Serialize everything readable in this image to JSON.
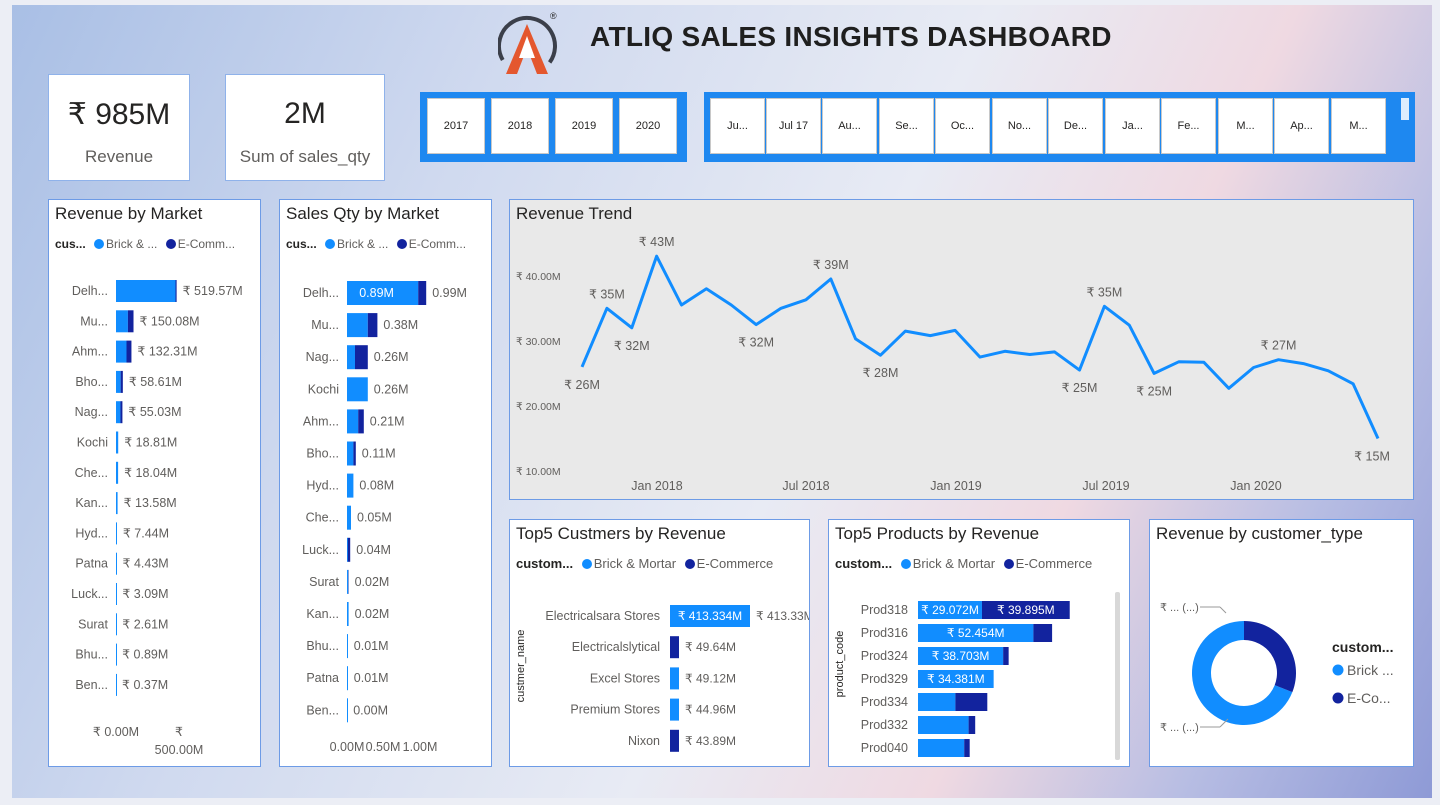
{
  "header": {
    "title": "ATLIQ SALES INSIGHTS DASHBOARD",
    "registered_mark": "®"
  },
  "colors": {
    "brick": "#118dff",
    "ecom": "#12239e",
    "logo_orange": "#e4572e",
    "logo_dark": "#3b3f4a"
  },
  "kpis": [
    {
      "value": "₹ 985M",
      "label": "Revenue"
    },
    {
      "value": "2M",
      "label": "Sum of sales_qty"
    }
  ],
  "year_slicer": [
    "2017",
    "2018",
    "2019",
    "2020"
  ],
  "month_slicer": [
    "Ju...",
    "Jul 17",
    "Au...",
    "Se...",
    "Oc...",
    "No...",
    "De...",
    "Ja...",
    "Fe...",
    "M...",
    "Ap...",
    "M..."
  ],
  "legend_common": {
    "brick_short": "Brick & ...",
    "ecom_short": "E-Comm...",
    "brick_full": "Brick & Mortar",
    "ecom_full": "E-Commerce"
  },
  "chart_data": [
    {
      "id": "revenue_by_market",
      "type": "bar",
      "title": "Revenue by Market",
      "legend_title": "cus...",
      "categories": [
        "Delh...",
        "Mu...",
        "Ahm...",
        "Bho...",
        "Nag...",
        "Kochi",
        "Che...",
        "Kan...",
        "Hyd...",
        "Patna",
        "Luck...",
        "Surat",
        "Bhu...",
        "Ben..."
      ],
      "series": [
        {
          "name": "Brick & ...",
          "values": [
            510,
            102,
            90,
            40,
            38,
            18.81,
            18.04,
            13.58,
            7.44,
            4.43,
            3.09,
            2.61,
            0.89,
            0.37
          ]
        },
        {
          "name": "E-Comm...",
          "values": [
            9.57,
            48.08,
            42.31,
            18.61,
            17.03,
            0,
            0,
            0,
            0,
            0,
            0,
            0,
            0,
            0
          ]
        }
      ],
      "data_labels": [
        "₹ 519.57M",
        "₹ 150.08M",
        "₹ 132.31M",
        "₹ 58.61M",
        "₹ 55.03M",
        "₹ 18.81M",
        "₹ 18.04M",
        "₹ 13.58M",
        "₹ 7.44M",
        "₹ 4.43M",
        "₹ 3.09M",
        "₹ 2.61M",
        "₹ 0.89M",
        "₹ 0.37M"
      ],
      "x_ticks": [
        "₹ 0.00M",
        "₹",
        "500.00M"
      ],
      "xlim": [
        0,
        600
      ]
    },
    {
      "id": "sales_qty_by_market",
      "type": "bar",
      "title": "Sales Qty by Market",
      "legend_title": "cus...",
      "categories": [
        "Delh...",
        "Mu...",
        "Nag...",
        "Kochi",
        "Ahm...",
        "Bho...",
        "Hyd...",
        "Che...",
        "Luck...",
        "Surat",
        "Kan...",
        "Bhu...",
        "Patna",
        "Ben..."
      ],
      "series": [
        {
          "name": "Brick & ...",
          "values": [
            0.89,
            0.26,
            0.1,
            0.26,
            0.14,
            0.08,
            0.08,
            0.05,
            0.01,
            0.015,
            0.02,
            0.01,
            0.01,
            0.003
          ]
        },
        {
          "name": "E-Comm...",
          "values": [
            0.1,
            0.12,
            0.16,
            0,
            0.07,
            0.03,
            0,
            0,
            0.03,
            0.005,
            0,
            0,
            0,
            0
          ]
        }
      ],
      "inner_label": "0.89M",
      "data_labels": [
        "0.99M",
        "0.38M",
        "0.26M",
        "0.26M",
        "0.21M",
        "0.11M",
        "0.08M",
        "0.05M",
        "0.04M",
        "0.02M",
        "0.02M",
        "0.01M",
        "0.01M",
        "0.00M"
      ],
      "x_ticks": [
        "0.00M",
        "0.50M",
        "1.00M"
      ],
      "xlim": [
        0,
        1.0
      ]
    },
    {
      "id": "revenue_trend",
      "type": "line",
      "title": "Revenue Trend",
      "x": [
        "2017-06",
        "2017-07",
        "2017-08",
        "2017-09",
        "2017-10",
        "2017-11",
        "2017-12",
        "2018-01",
        "2018-02",
        "2018-03",
        "2018-04",
        "2018-05",
        "2018-06",
        "2018-07",
        "2018-08",
        "2018-09",
        "2018-10",
        "2018-11",
        "2018-12",
        "2019-01",
        "2019-02",
        "2019-03",
        "2019-04",
        "2019-05",
        "2019-06",
        "2019-07",
        "2019-08",
        "2019-09",
        "2019-10",
        "2019-11",
        "2019-12",
        "2020-01",
        "2020-02",
        "2020-03",
        "2020-04",
        "2020-05",
        "2020-06"
      ],
      "values": [
        26,
        35,
        32,
        43,
        35.5,
        38,
        35.5,
        32.5,
        35,
        36.3,
        39.5,
        30.3,
        27.8,
        31.5,
        30.8,
        31.6,
        27.5,
        28.4,
        27.9,
        28.3,
        25.5,
        35.3,
        32.4,
        25,
        26.8,
        26.7,
        22.7,
        25.9,
        27.1,
        26.5,
        25.4,
        23.4,
        15
      ],
      "point_labels": [
        {
          "index": 0,
          "text": "₹ 26M"
        },
        {
          "index": 1,
          "text": "₹ 35M"
        },
        {
          "index": 2,
          "text": "₹ 32M"
        },
        {
          "index": 3,
          "text": "₹ 43M"
        },
        {
          "index": 7,
          "text": "₹ 32M"
        },
        {
          "index": 10,
          "text": "₹ 39M"
        },
        {
          "index": 12,
          "text": "₹ 28M"
        },
        {
          "index": 20,
          "text": "₹ 25M"
        },
        {
          "index": 21,
          "text": "₹ 35M"
        },
        {
          "index": 23,
          "text": "₹ 25M"
        },
        {
          "index": 28,
          "text": "₹ 27M"
        },
        {
          "index": 32,
          "text": "₹ 15M"
        }
      ],
      "y_ticks": [
        "₹ 40.00M",
        "₹ 30.00M",
        "₹ 20.00M",
        "₹ 10.00M"
      ],
      "y_tick_values": [
        40,
        30,
        20,
        10
      ],
      "x_ticks": [
        "Jan 2018",
        "Jul 2018",
        "Jan 2019",
        "Jul 2019",
        "Jan 2020"
      ],
      "ylim": [
        10,
        45
      ]
    },
    {
      "id": "top5_customers",
      "type": "bar",
      "title": "Top5 Custmers by Revenue",
      "legend_title": "custom...",
      "y_axis_label": "custmer_name",
      "categories": [
        "Electricalsara Stores",
        "Electricalslytical",
        "Excel Stores",
        "Premium Stores",
        "Nixon"
      ],
      "series": [
        {
          "name": "Brick & Mortar",
          "values": [
            413.334,
            0,
            49.12,
            44.96,
            0
          ]
        },
        {
          "name": "E-Commerce",
          "values": [
            0,
            49.64,
            0,
            0,
            43.89
          ]
        }
      ],
      "inner_label": "₹ 413.334M",
      "data_labels": [
        "₹ 413.33M",
        "₹ 49.64M",
        "₹ 49.12M",
        "₹ 44.96M",
        "₹ 43.89M"
      ],
      "xlim": [
        0,
        420
      ]
    },
    {
      "id": "top5_products",
      "type": "bar",
      "title": "Top5 Products by Revenue",
      "legend_title": "custom...",
      "y_axis_label": "product_code",
      "categories": [
        "Prod318",
        "Prod316",
        "Prod324",
        "Prod329",
        "Prod334",
        "Prod332",
        "Prod040"
      ],
      "series": [
        {
          "name": "Brick & Mortar",
          "values": [
            29.072,
            52.454,
            38.703,
            34.381,
            17,
            23,
            21
          ]
        },
        {
          "name": "E-Commerce",
          "values": [
            39.895,
            8.5,
            2.5,
            0,
            14.5,
            3,
            2.5
          ]
        }
      ],
      "brick_labels": [
        "₹ 29.072M",
        "₹ 52.454M",
        "₹ 38.703M",
        "₹ 34.381M",
        "",
        "",
        ""
      ],
      "ecom_labels": [
        "₹ 39.895M",
        "",
        "",
        "",
        "",
        "",
        ""
      ],
      "xlim": [
        0,
        75
      ]
    },
    {
      "id": "revenue_by_customer_type",
      "type": "pie",
      "title": "Revenue by customer_type",
      "legend_title": "custom...",
      "slices": [
        {
          "name": "Brick ...",
          "value": 69
        },
        {
          "name": "E-Co...",
          "value": 31
        }
      ],
      "slice_labels": [
        "₹ ... (...)",
        "₹ ... (...)"
      ]
    }
  ]
}
